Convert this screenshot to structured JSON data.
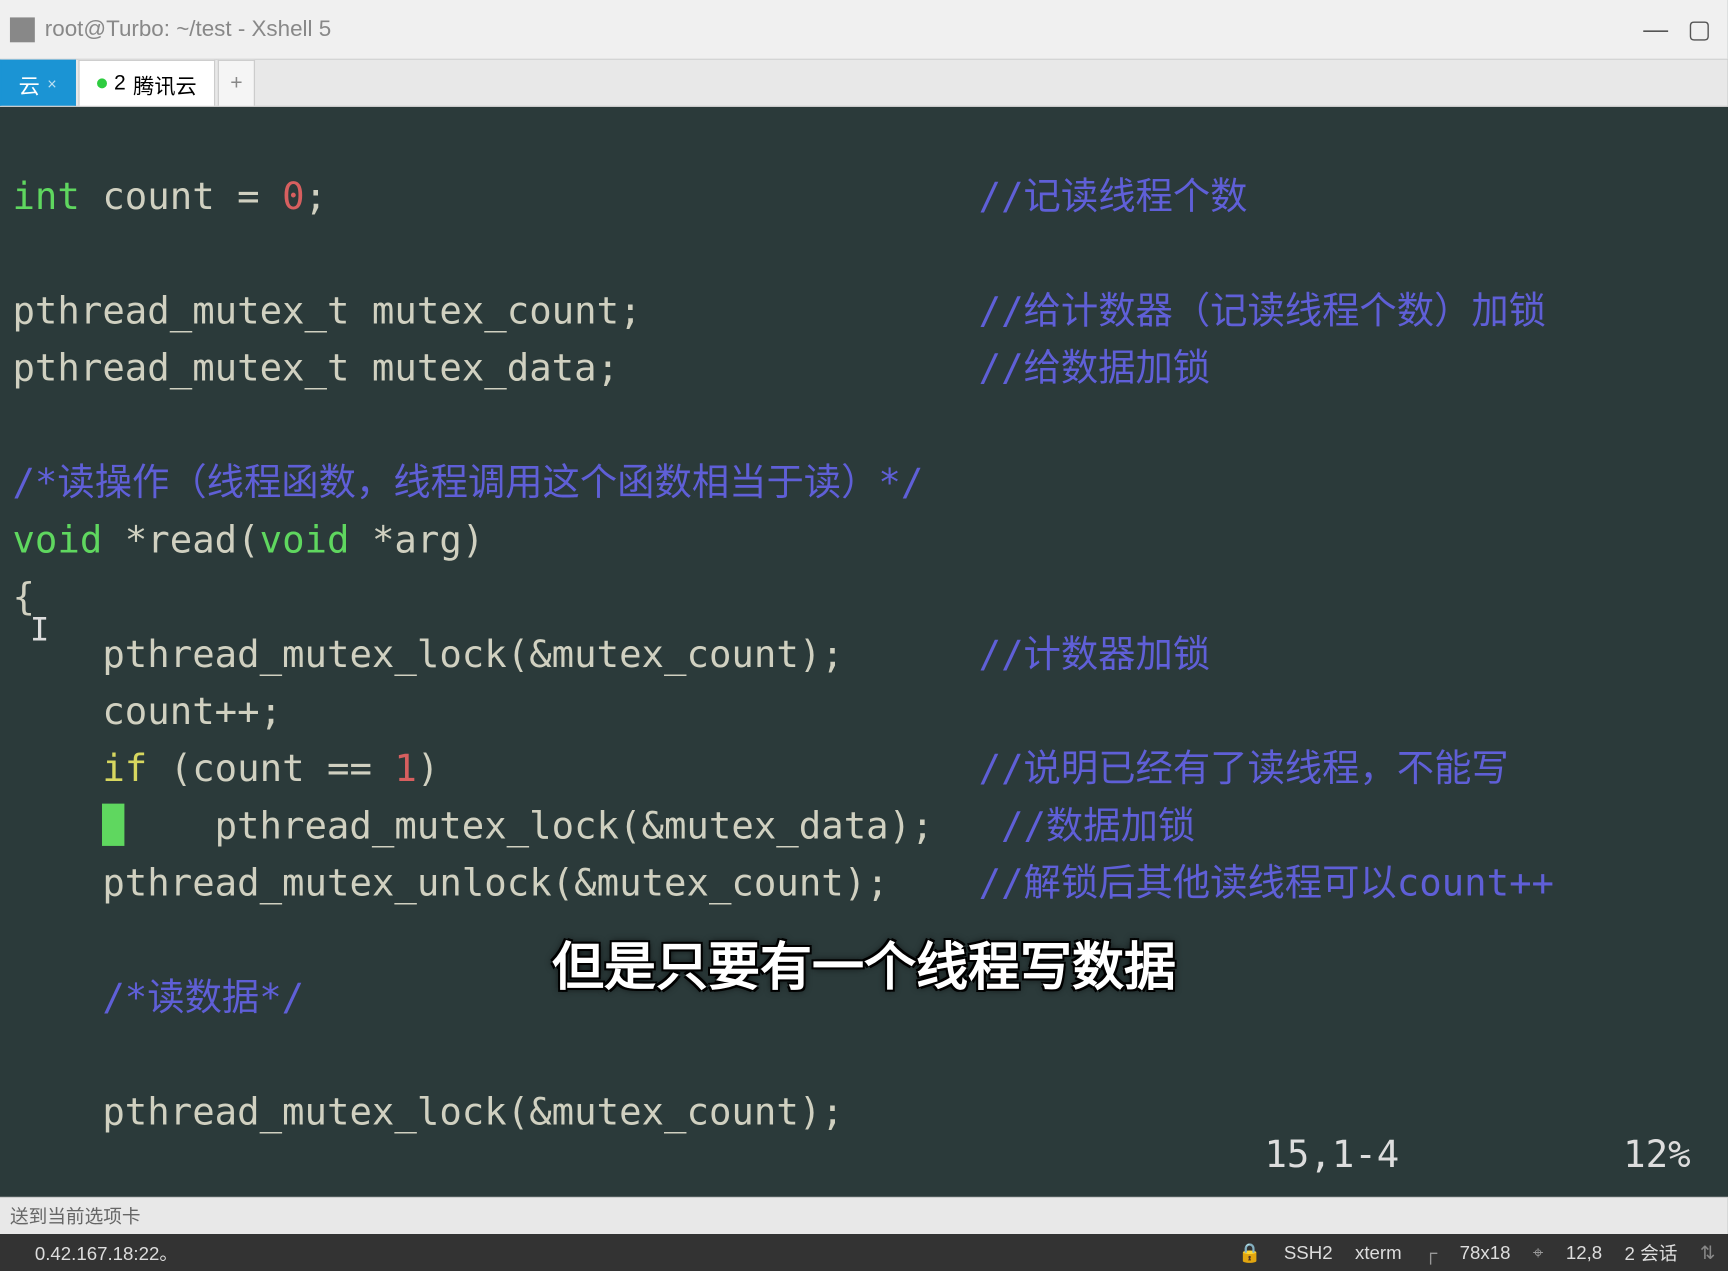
{
  "window": {
    "title": "root@Turbo: ~/test - Xshell 5"
  },
  "tabs": {
    "primary": "云",
    "secondary_prefix": "2",
    "secondary_label": "腾讯云"
  },
  "code": {
    "l1_kw": "int",
    "l1_rest": " count = ",
    "l1_num": "0",
    "l1_semi": ";",
    "c1": "//记读线程个数",
    "l2": "pthread_mutex_t mutex_count;",
    "c2": "//给计数器（记读线程个数）加锁",
    "l3": "pthread_mutex_t mutex_data;",
    "c3": "//给数据加锁",
    "c4": "/*读操作（线程函数，线程调用这个函数相当于读）*/",
    "l5_kw": "void",
    "l5_mid": " *read(",
    "l5_kw2": "void",
    "l5_end": " *arg)",
    "l6": "{",
    "l7": "    pthread_mutex_lock(&mutex_count);",
    "c7": "//计数器加锁",
    "l8": "    count++;",
    "l9a": "    ",
    "l9_kw": "if",
    "l9b": " (count == ",
    "l9_num": "1",
    "l9c": ")",
    "c9": "//说明已经有了读线程，不能写",
    "l10pre": "    ",
    "l10": "    pthread_mutex_lock(&mutex_data);",
    "c10": "//数据加锁",
    "l11": "    pthread_mutex_unlock(&mutex_count);",
    "c11": "//解锁后其他读线程可以count++",
    "c12": "    /*读数据*/",
    "l13": "    pthread_mutex_lock(&mutex_count);"
  },
  "vim": {
    "pos": "15,1-4",
    "pct": "12%"
  },
  "footer": {
    "hint": "送到当前选项卡",
    "ip": "0.42.167.18:22。",
    "ssh": "SSH2",
    "term": "xterm",
    "size": "78x18",
    "cursor": "12,8",
    "sessions": "2 会话"
  },
  "subtitle": "但是只要有一个线程写数据"
}
